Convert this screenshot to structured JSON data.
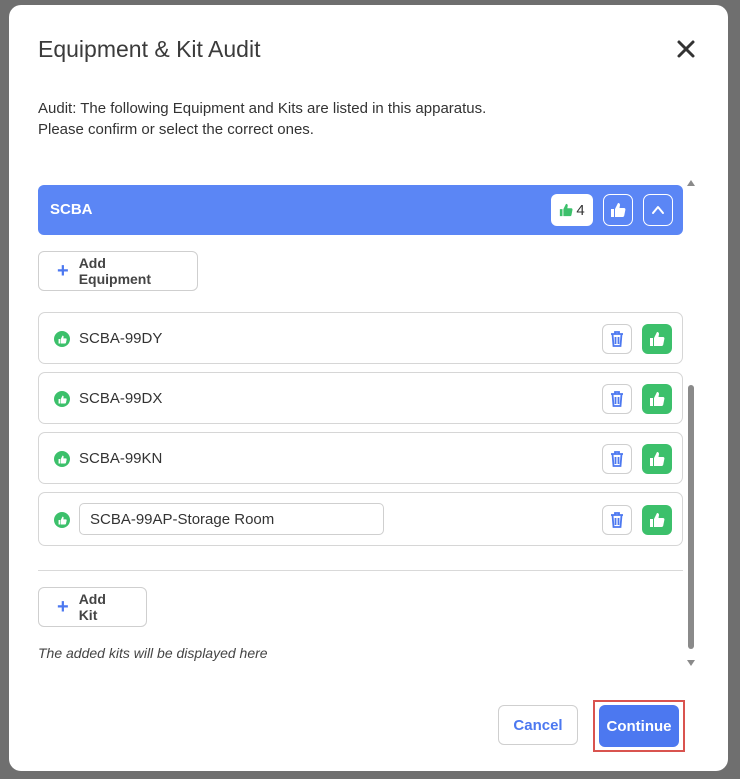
{
  "modal": {
    "title": "Equipment & Kit Audit",
    "intro_line1": "Audit: The following Equipment and Kits are listed in this apparatus.",
    "intro_line2": "Please confirm or select the correct ones."
  },
  "category": {
    "name": "SCBA",
    "approved_count": "4"
  },
  "add_equipment_label": "Add Equipment",
  "equipment": [
    {
      "name": "SCBA-99DY"
    },
    {
      "name": "SCBA-99DX"
    },
    {
      "name": "SCBA-99KN"
    },
    {
      "name": "SCBA-99AP-Storage Room"
    }
  ],
  "add_kit_label": "Add Kit",
  "kits_placeholder": "The added kits will be displayed here",
  "footer": {
    "cancel_label": "Cancel",
    "continue_label": "Continue"
  },
  "colors": {
    "primary": "#4c78f0",
    "category_bar": "#5b86f5",
    "approved_green": "#3cc06b",
    "highlight_red": "#d9534f"
  }
}
